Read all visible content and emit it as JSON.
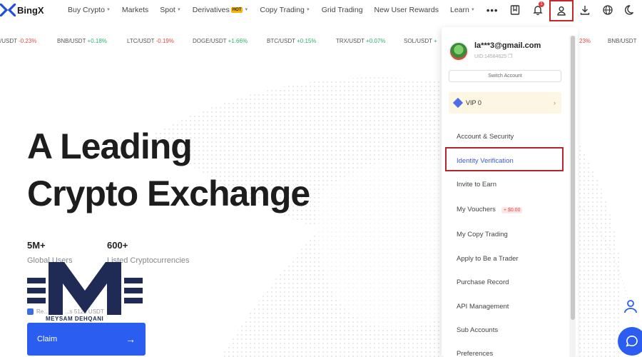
{
  "brand": {
    "name": "BingX"
  },
  "nav": {
    "items": [
      {
        "label": "Buy Crypto",
        "caret": true
      },
      {
        "label": "Markets",
        "caret": false
      },
      {
        "label": "Spot",
        "caret": true
      },
      {
        "label": "Derivatives",
        "caret": true,
        "badge": "HOT"
      },
      {
        "label": "Copy Trading",
        "caret": true
      },
      {
        "label": "Grid Trading",
        "caret": false
      },
      {
        "label": "New User Rewards",
        "caret": false
      },
      {
        "label": "Learn",
        "caret": true
      }
    ],
    "more": "•••",
    "notification_count": "1",
    "icons": [
      "orders-icon",
      "bell-icon",
      "user-icon",
      "download-icon",
      "globe-icon",
      "moon-icon"
    ]
  },
  "ticker": [
    {
      "pair": "/USDT",
      "change": "-0.23%",
      "direction": "down"
    },
    {
      "pair": "BNB/USDT",
      "change": "+0.18%",
      "direction": "up"
    },
    {
      "pair": "LTC/USDT",
      "change": "-0.19%",
      "direction": "down"
    },
    {
      "pair": "DOGE/USDT",
      "change": "+1.66%",
      "direction": "up"
    },
    {
      "pair": "BTC/USDT",
      "change": "+0.15%",
      "direction": "up"
    },
    {
      "pair": "TRX/USDT",
      "change": "+0.07%",
      "direction": "up"
    },
    {
      "pair": "SOL/USDT",
      "change": "+",
      "direction": "up"
    },
    {
      "pair": "",
      "change": "23%",
      "direction": "up"
    },
    {
      "pair": "BNB/USDT",
      "change": "",
      "direction": "up"
    }
  ],
  "hero": {
    "title_line1": "A Leading",
    "title_line2": "Crypto Exchange",
    "stats": [
      {
        "value": "5M+",
        "label": "Global Users"
      },
      {
        "value": "600+",
        "label": "Listed Cryptocurrencies"
      }
    ],
    "reward_text": "Re...  Cla...  ...s 5125 USDT",
    "claim_label": "Claim",
    "claim_arrow": "→"
  },
  "watermark": {
    "text": "MEYSAM DEHQANI"
  },
  "account_menu": {
    "email": "la***3@gmail.com",
    "uid": "UID:14584625",
    "switch_label": "Switch Account",
    "vip_label": "VIP 0",
    "vip_chevron": "›",
    "items": [
      {
        "label": "Account & Security",
        "active": false
      },
      {
        "label": "Identity Verification",
        "active": true
      },
      {
        "label": "Invite to Earn",
        "active": false
      },
      {
        "label": "My Vouchers",
        "active": false,
        "badge": "+ $0.00"
      },
      {
        "label": "My Copy Trading",
        "active": false
      },
      {
        "label": "Apply to Be a Trader",
        "active": false
      },
      {
        "label": "Purchase Record",
        "active": false
      },
      {
        "label": "API Management",
        "active": false
      },
      {
        "label": "Sub Accounts",
        "active": false
      },
      {
        "label": "Preferences",
        "active": false
      }
    ]
  },
  "colors": {
    "accent": "#2a5df0",
    "highlight": "#b5252d",
    "up": "#2bb36b",
    "down": "#e24a4a",
    "vip_bg": "#fdf6e3"
  }
}
